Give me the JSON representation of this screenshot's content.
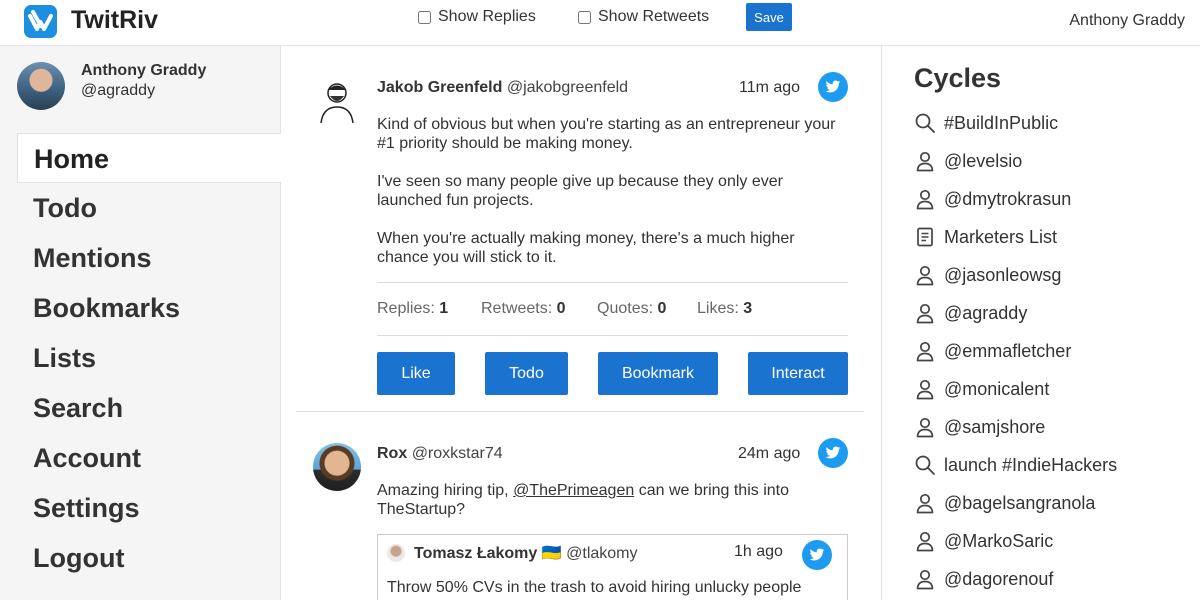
{
  "app": {
    "title": "TwitRiv",
    "show_replies_label": "Show Replies",
    "show_retweets_label": "Show Retweets",
    "save_label": "Save",
    "current_user": "Anthony Graddy"
  },
  "sidebar": {
    "profile_name": "Anthony Graddy",
    "profile_handle": "@agraddy",
    "items": [
      {
        "label": "Home",
        "active": true
      },
      {
        "label": "Todo"
      },
      {
        "label": "Mentions"
      },
      {
        "label": "Bookmarks"
      },
      {
        "label": "Lists"
      },
      {
        "label": "Search"
      },
      {
        "label": "Account"
      },
      {
        "label": "Settings"
      },
      {
        "label": "Logout"
      }
    ]
  },
  "tweets": [
    {
      "author": "Jakob Greenfeld",
      "handle": "@jakobgreenfeld",
      "time": "11m ago",
      "paragraphs": [
        "Kind of obvious but when you're starting as an entrepreneur your #1 priority should be making money.",
        "I've seen so many people give up because they only ever launched fun projects.",
        "When you're actually making money, there's a much higher chance you will stick to it."
      ],
      "stats": {
        "replies_label": "Replies:",
        "replies": "1",
        "retweets_label": "Retweets:",
        "retweets": "0",
        "quotes_label": "Quotes:",
        "quotes": "0",
        "likes_label": "Likes:",
        "likes": "3"
      },
      "actions": {
        "like": "Like",
        "todo": "Todo",
        "bookmark": "Bookmark",
        "interact": "Interact"
      }
    },
    {
      "author": "Rox",
      "handle": "@roxkstar74",
      "time": "24m ago",
      "text_before": "Amazing hiring tip, ",
      "mention": "@ThePrimeagen",
      "text_after": " can we bring this into TheStartup?",
      "quote": {
        "author": "Tomasz Łakomy 🇺🇦",
        "handle": "@tlakomy",
        "time": "1h ago",
        "text": "Throw 50% CVs in the trash to avoid hiring unlucky people"
      }
    }
  ],
  "cycles": {
    "title": "Cycles",
    "items": [
      {
        "icon": "search-icon",
        "label": "#BuildInPublic"
      },
      {
        "icon": "user-icon",
        "label": "@levelsio"
      },
      {
        "icon": "user-icon",
        "label": "@dmytrokrasun"
      },
      {
        "icon": "list-icon",
        "label": "Marketers List"
      },
      {
        "icon": "user-icon",
        "label": "@jasonleowsg"
      },
      {
        "icon": "user-icon",
        "label": "@agraddy"
      },
      {
        "icon": "user-icon",
        "label": "@emmafletcher"
      },
      {
        "icon": "user-icon",
        "label": "@monicalent"
      },
      {
        "icon": "user-icon",
        "label": "@samjshore"
      },
      {
        "icon": "search-icon",
        "label": "launch #IndieHackers"
      },
      {
        "icon": "user-icon",
        "label": "@bagelsangranola"
      },
      {
        "icon": "user-icon",
        "label": "@MarkoSaric"
      },
      {
        "icon": "user-icon",
        "label": "@dagorenouf"
      }
    ]
  },
  "colors": {
    "accent": "#1a73cf",
    "twitter_blue": "#1d9bf0",
    "sidebar_bg": "#f5f5f5"
  }
}
